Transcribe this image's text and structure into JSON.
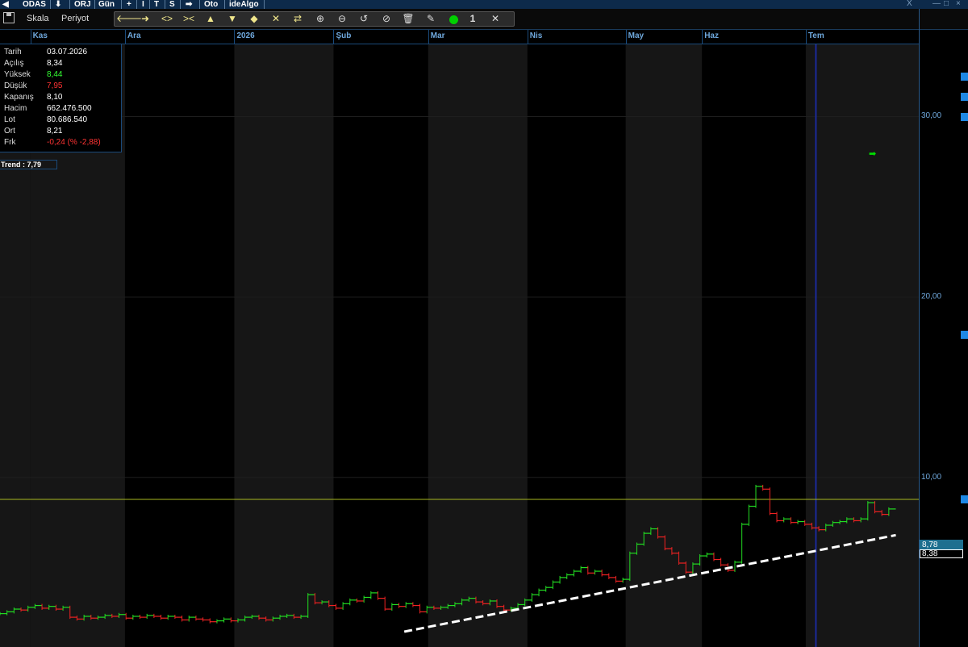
{
  "topbar": {
    "symbol": "ODAS",
    "orj": "ORJ",
    "gun": "Gün",
    "plus": "+",
    "i": "I",
    "t": "T",
    "s": "S",
    "oto": "Oto",
    "idealgo": "ideAlgo",
    "close_x": "X",
    "min": "—",
    "max": "□",
    "close": "×"
  },
  "bar2": {
    "skala": "Skala",
    "periyot": "Periyot",
    "line_width": "1"
  },
  "info_panel": {
    "rows": [
      {
        "label": "Tarih",
        "value": "03.07.2026",
        "color": "#ffffff"
      },
      {
        "label": "Açılış",
        "value": "8,34",
        "color": "#ffffff"
      },
      {
        "label": "Yüksek",
        "value": "8,44",
        "color": "#33ff33"
      },
      {
        "label": "Düşük",
        "value": "7,95",
        "color": "#ff3333"
      },
      {
        "label": "Kapanış",
        "value": "8,10",
        "color": "#ffffff"
      },
      {
        "label": "Hacim",
        "value": "662.476.500",
        "color": "#ffffff"
      },
      {
        "label": "Lot",
        "value": "80.686.540",
        "color": "#ffffff"
      },
      {
        "label": "Ort",
        "value": "8,21",
        "color": "#ffffff"
      },
      {
        "label": "Frk",
        "value": "-0,24 (% -2,88)",
        "color": "#ff3333"
      }
    ],
    "trend_label": "Trend :  7,79"
  },
  "price_labels": {
    "last": "8,78",
    "prev": "8,38"
  },
  "chart_data": {
    "type": "line",
    "title": "",
    "months": [
      "Kas",
      "Ara",
      "2026",
      "Şub",
      "Mar",
      "Nis",
      "May",
      "Haz",
      "Tem"
    ],
    "y_ticks": [
      "30,00",
      "20,00",
      "10,00"
    ],
    "ylim": [
      0.6,
      34.0
    ],
    "horizontal_line": 8.78,
    "trendline": {
      "start": [
        0.44,
        1.45
      ],
      "end": [
        0.975,
        6.8
      ],
      "style": "dashed",
      "color": "#ffffff"
    },
    "price_series_note": "daily candles ODAS",
    "series": [
      {
        "values": [
          2.45,
          2.55,
          2.7,
          2.65,
          2.8,
          2.9,
          2.75,
          2.85,
          2.7,
          2.8,
          2.25,
          2.15,
          2.3,
          2.2,
          2.25,
          2.35,
          2.3,
          2.4,
          2.2,
          2.3,
          2.25,
          2.35,
          2.3,
          2.2,
          2.3,
          2.25,
          2.1,
          2.25,
          2.15,
          2.1,
          2.0,
          2.05,
          2.15,
          2.05,
          2.1,
          2.25,
          2.3,
          2.2,
          2.1,
          2.2,
          2.3,
          2.35,
          2.25,
          2.3,
          3.5,
          3.05,
          3.1,
          2.9,
          2.75,
          3.0,
          3.2,
          3.15,
          3.35,
          3.6,
          3.3,
          2.7,
          2.95,
          2.85,
          3.0,
          2.9,
          2.55,
          2.8,
          2.75,
          2.8,
          2.9,
          3.0,
          3.2,
          3.3,
          3.1,
          3.0,
          3.15,
          2.85,
          2.65,
          2.75,
          2.95,
          3.2,
          3.5,
          3.75,
          3.9,
          4.2,
          4.45,
          4.6,
          4.8,
          5.0,
          4.7,
          4.8,
          4.6,
          4.45,
          4.25,
          4.35,
          5.8,
          6.3,
          6.9,
          7.15,
          6.7,
          6.05,
          5.8,
          5.25,
          4.75,
          5.2,
          5.65,
          5.75,
          5.45,
          5.15,
          4.85,
          5.3,
          7.4,
          8.4,
          9.5,
          9.35,
          8.0,
          7.6,
          7.7,
          7.5,
          7.55,
          7.4,
          7.2,
          7.1,
          7.35,
          7.5,
          7.55,
          7.7,
          7.6,
          7.7,
          8.6,
          8.1,
          7.95,
          8.25
        ]
      }
    ]
  }
}
